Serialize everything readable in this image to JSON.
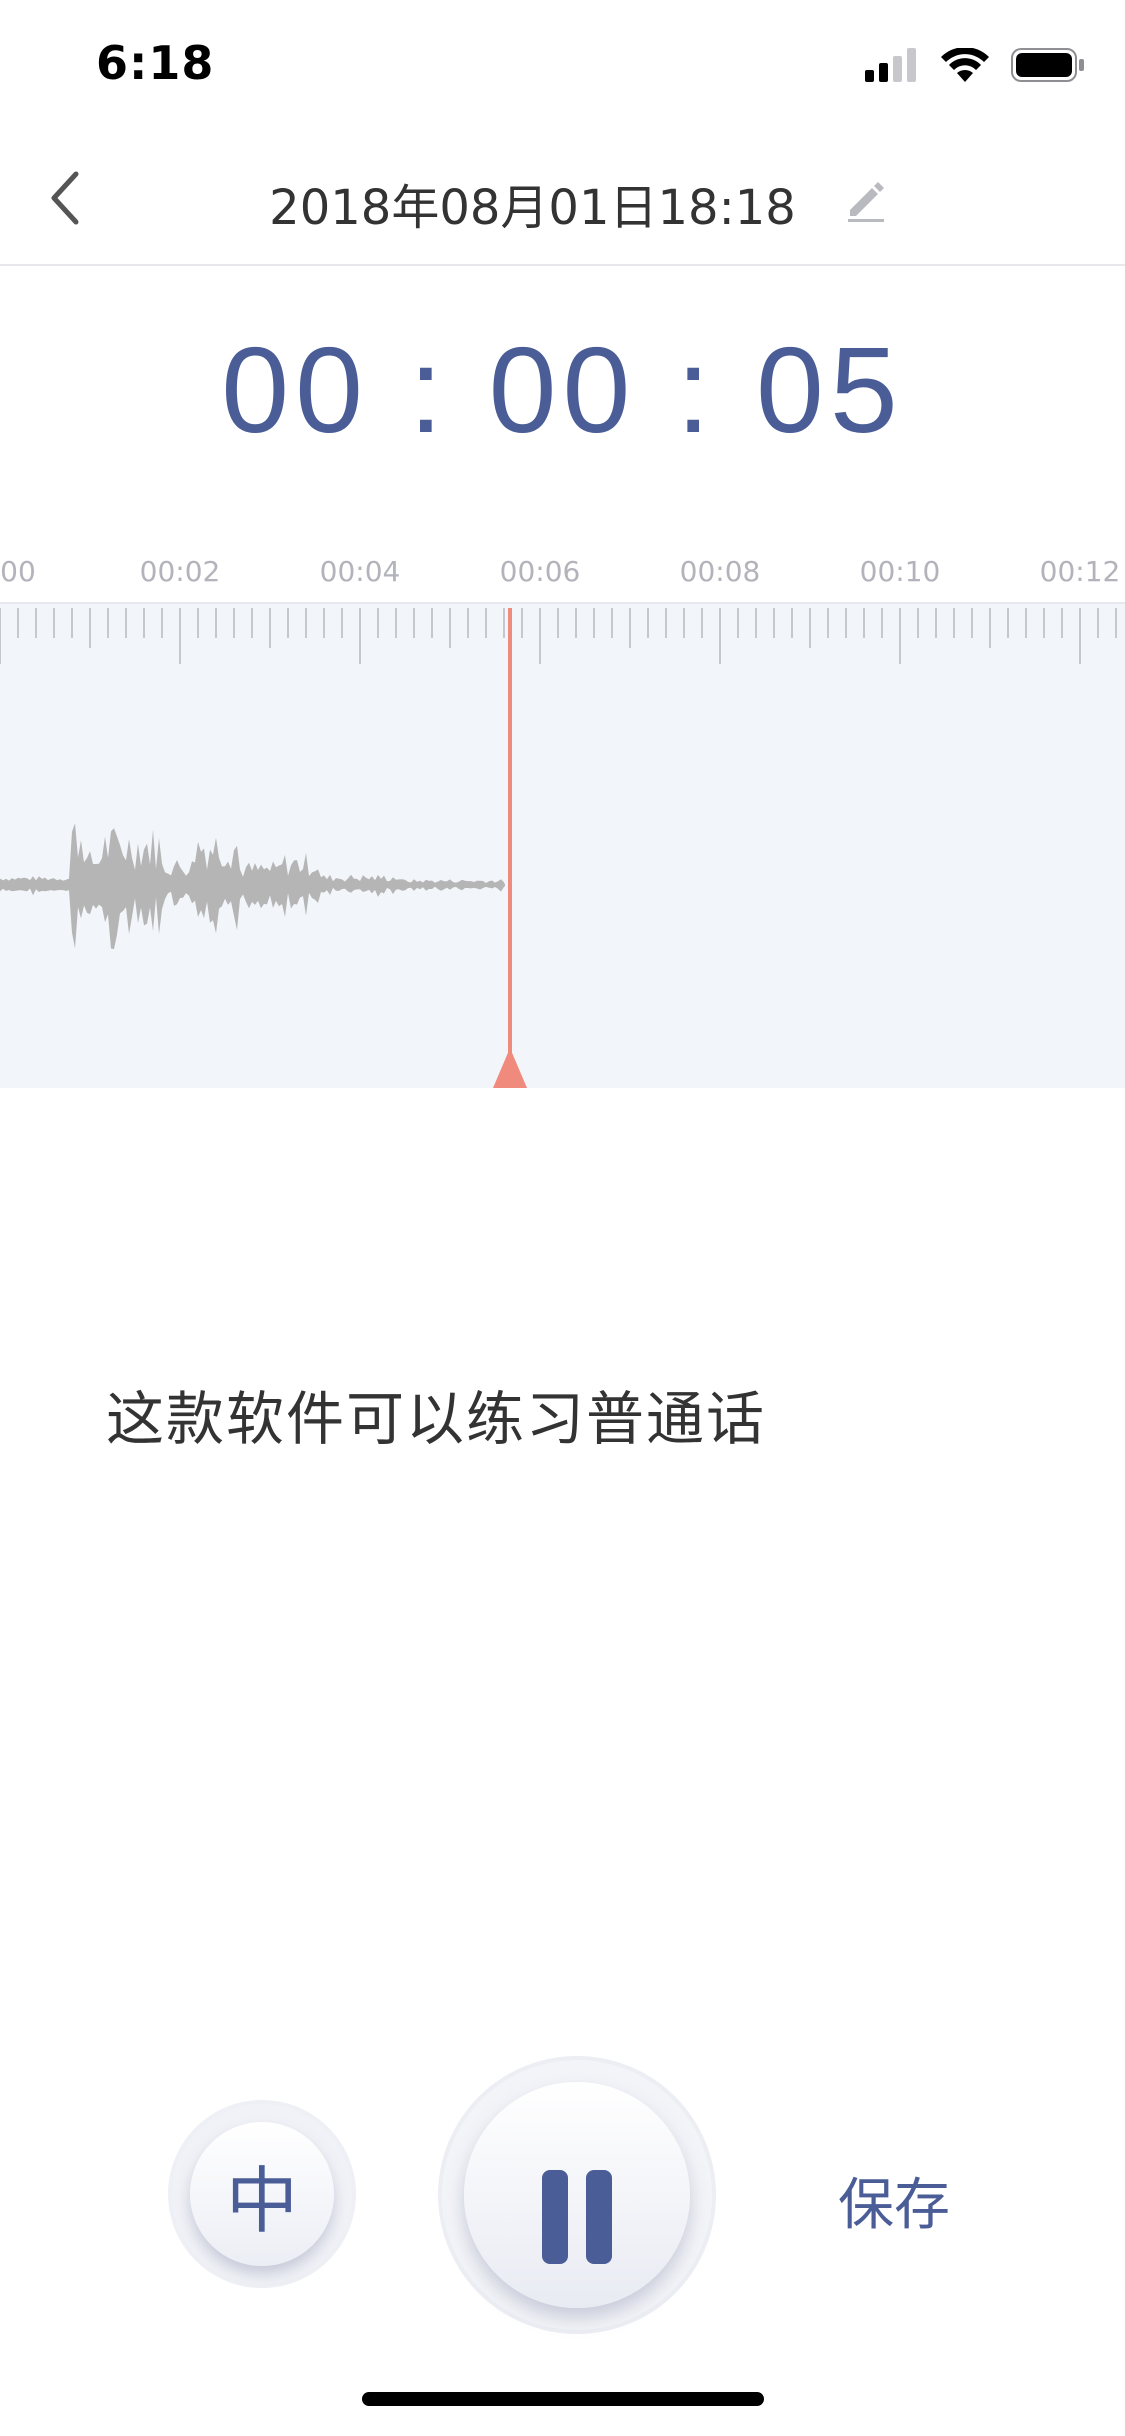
{
  "status_bar": {
    "time": "6:18"
  },
  "nav": {
    "title": "2018年08月01日18:18"
  },
  "timer": {
    "display": "00 : 00 : 05"
  },
  "ruler": {
    "labels": [
      "00",
      "00:02",
      "00:04",
      "00:06",
      "00:08",
      "00:10",
      "00:12"
    ]
  },
  "transcript": {
    "text": "这款软件可以练习普通话"
  },
  "controls": {
    "language_label": "中",
    "save_label": "保存"
  },
  "colors": {
    "accent": "#4a5d97",
    "playhead": "#ef8a7c",
    "waveform": "#b5b5b5",
    "wave_background": "#f2f5f9"
  }
}
